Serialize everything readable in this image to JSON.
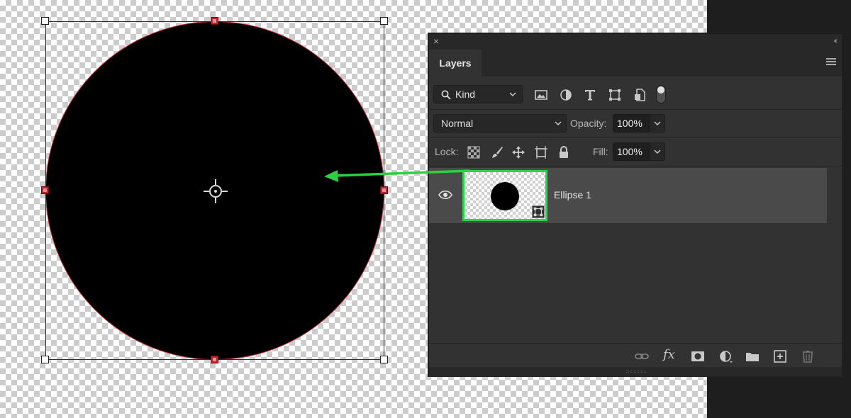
{
  "canvas": {
    "shape": "ellipse",
    "fill_color": "#000000",
    "path_color": "#c8303a"
  },
  "annotation": {
    "arrow_color": "#2bd13f"
  },
  "panel": {
    "tab_label": "Layers",
    "icons": {
      "close": "close-icon",
      "collapse": "collapse-icon",
      "menu": "panel-menu-icon"
    },
    "filter": {
      "kind_label": "Kind",
      "icons": [
        "image-filter-icon",
        "adjustment-filter-icon",
        "type-filter-icon",
        "shape-filter-icon",
        "smart-object-filter-icon"
      ]
    },
    "blend_mode": "Normal",
    "opacity_label": "Opacity:",
    "opacity_value": "100%",
    "lock_label": "Lock:",
    "lock_icons": [
      "lock-transparent-icon",
      "lock-image-icon",
      "lock-position-icon",
      "lock-artboard-icon",
      "lock-all-icon"
    ],
    "fill_label": "Fill:",
    "fill_value": "100%",
    "layers": [
      {
        "name": "Ellipse 1",
        "visible": true,
        "type": "shape",
        "highlight_color": "#29d44a"
      }
    ],
    "bottom_icons": [
      "link-icon",
      "fx-icon",
      "mask-icon",
      "adjustment-icon",
      "group-folder-icon",
      "new-layer-icon",
      "trash-icon"
    ],
    "fx_label": "fx"
  },
  "colors": {
    "panel_bg": "#323232",
    "selected_layer_bg": "#4a4a4a",
    "accent_green": "#29d44a"
  }
}
